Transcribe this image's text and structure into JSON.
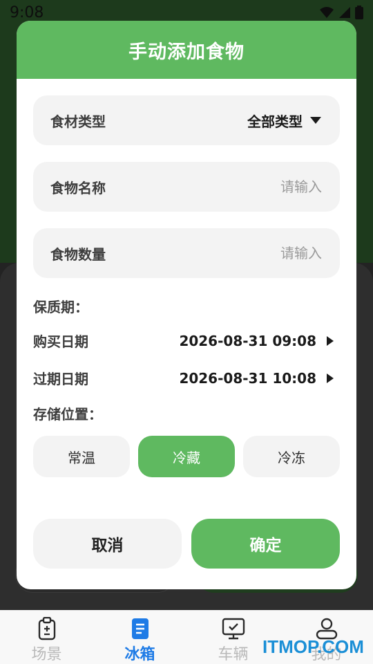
{
  "status": {
    "time": "9:08"
  },
  "dialog": {
    "title": "手动添加食物",
    "category": {
      "label": "食材类型",
      "value": "全部类型"
    },
    "name": {
      "label": "食物名称",
      "placeholder": "请输入"
    },
    "quantity": {
      "label": "食物数量",
      "placeholder": "请输入"
    },
    "shelf_life_label": "保质期：",
    "purchase": {
      "label": "购买日期",
      "value": "2026-08-31 09:08"
    },
    "expiry": {
      "label": "过期日期",
      "value": "2026-08-31 10:08"
    },
    "storage_label": "存储位置：",
    "storage_options": [
      "常温",
      "冷藏",
      "冷冻"
    ],
    "storage_selected": "冷藏",
    "cancel_label": "取消",
    "confirm_label": "确定"
  },
  "tabs": [
    {
      "label": "场景",
      "icon": "clipboard-icon"
    },
    {
      "label": "冰箱",
      "icon": "fridge-icon",
      "active": true
    },
    {
      "label": "车辆",
      "icon": "monitor-icon"
    },
    {
      "label": "我的",
      "icon": "person-icon"
    }
  ],
  "watermark": "ITMOP.COM",
  "colors": {
    "accent": "#5fb960",
    "tab_active": "#1e7be6"
  }
}
